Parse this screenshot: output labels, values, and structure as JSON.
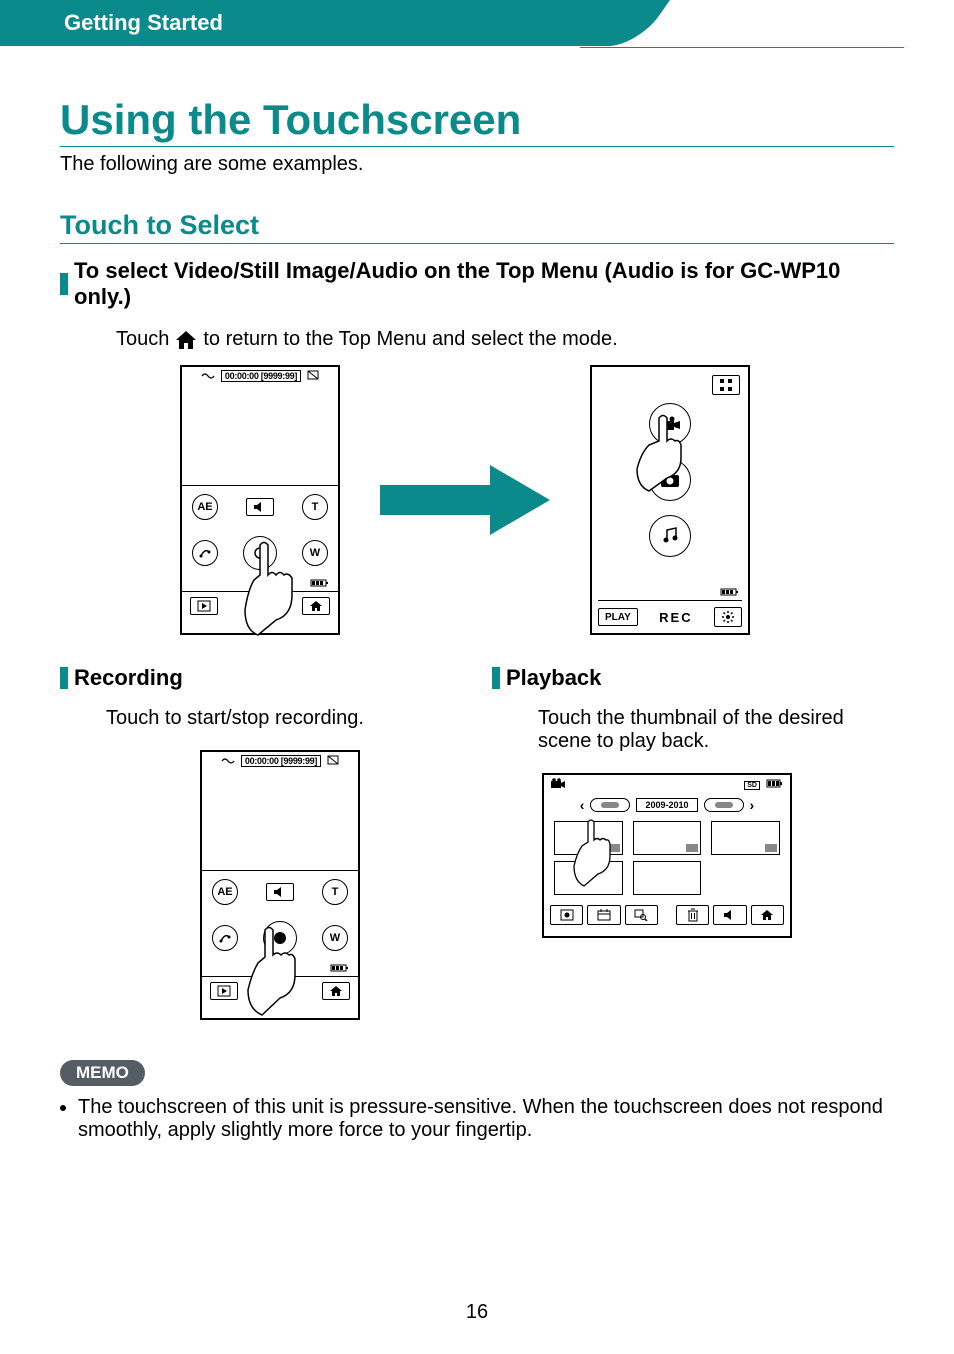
{
  "header": {
    "section": "Getting Started"
  },
  "title": "Using the Touchscreen",
  "intro": "The following are some examples.",
  "section1": {
    "heading": "Touch to Select",
    "bar_title": "To select Video/Still Image/Audio on the Top Menu (Audio is for GC-WP10 only.)",
    "step_pre": "Touch",
    "step_post": "to return to the Top Menu and select the mode."
  },
  "device_rec": {
    "timecode": "00:00:00 [9999:99]",
    "ae_label": "AE",
    "t_label": "T",
    "w_label": "W"
  },
  "topmenu": {
    "play_label": "PLAY",
    "rec_label": "REC"
  },
  "cols": {
    "recording": {
      "title": "Recording",
      "body": "Touch to start/stop recording."
    },
    "playback": {
      "title": "Playback",
      "body": "Touch the thumbnail of the desired scene to play back.",
      "date_range": "2009-2010",
      "sd_label": "SD"
    }
  },
  "memo": {
    "label": "MEMO",
    "item1": "The touchscreen of this unit is pressure-sensitive. When the touchscreen does not respond smoothly, apply slightly more force to your fingertip."
  },
  "page_number": "16"
}
